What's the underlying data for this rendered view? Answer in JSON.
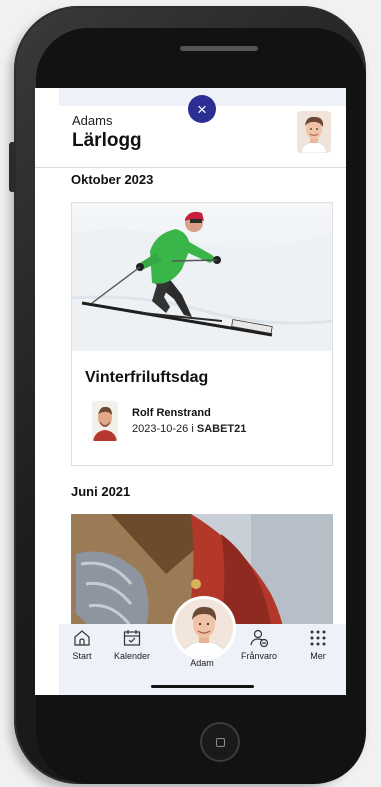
{
  "header": {
    "close_label": "×",
    "owner_name": "Adams",
    "title": "Lärlogg"
  },
  "sections": [
    {
      "heading": "Oktober 2023",
      "card": {
        "title": "Vinterfriluftsdag",
        "teacher": "Rolf Renstrand",
        "date": "2023-10-26",
        "separator": "i",
        "group": "SABET21"
      }
    },
    {
      "heading": "Juni 2021"
    }
  ],
  "nav": {
    "items": [
      {
        "label": "Start",
        "icon": "home-icon"
      },
      {
        "label": "Kalender",
        "icon": "calendar-icon"
      },
      {
        "label": "Adam",
        "icon": "avatar"
      },
      {
        "label": "Frånvaro",
        "icon": "absence-icon"
      },
      {
        "label": "Mer",
        "icon": "grid-dots-icon"
      }
    ]
  },
  "colors": {
    "accent": "#2b2f94",
    "nav_background": "#eef1f8",
    "skier_jacket": "#3ab54a"
  }
}
